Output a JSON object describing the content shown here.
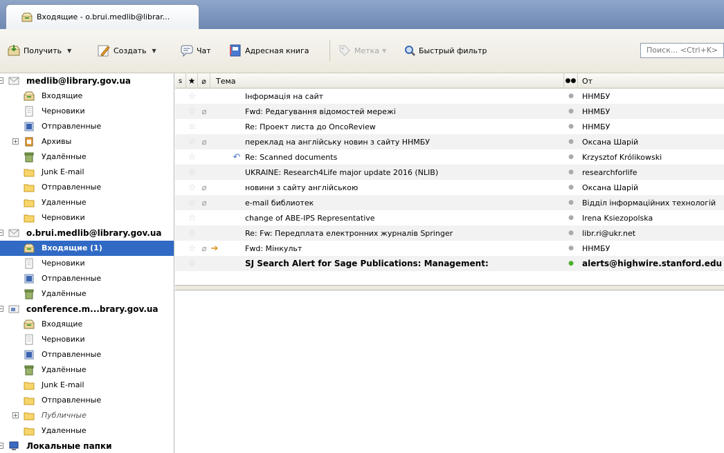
{
  "tab": {
    "label": "Входящие - o.brui.medlib@librar..."
  },
  "toolbar": {
    "get": "Получить",
    "create": "Создать",
    "chat": "Чат",
    "addressbook": "Адресная книга",
    "tag": "Метка",
    "quickfilter": "Быстрый фильтр",
    "search_placeholder": "Поиск... <Ctrl+K>"
  },
  "folders": [
    {
      "label": "medlib@library.gov.ua",
      "type": "account",
      "icon": "account-icon"
    },
    {
      "label": "Входящие",
      "type": "inbox",
      "icon": "inbox-icon"
    },
    {
      "label": "Черновики",
      "type": "drafts",
      "icon": "drafts-icon"
    },
    {
      "label": "Отправленные",
      "type": "sent",
      "icon": "sent-icon"
    },
    {
      "label": "Архивы",
      "type": "archive",
      "icon": "archive-icon"
    },
    {
      "label": "Удалённые",
      "type": "trash",
      "icon": "trash-icon"
    },
    {
      "label": "Junk E-mail",
      "type": "folder",
      "icon": "folder-icon"
    },
    {
      "label": "Отправленные",
      "type": "folder",
      "icon": "folder-icon"
    },
    {
      "label": "Удаленные",
      "type": "folder",
      "icon": "folder-icon"
    },
    {
      "label": "Черновики",
      "type": "folder",
      "icon": "folder-icon"
    },
    {
      "label": "o.brui.medlib@library.gov.ua",
      "type": "account",
      "icon": "account-icon"
    },
    {
      "label": "Входящие (1)",
      "type": "inbox",
      "icon": "inbox-icon"
    },
    {
      "label": "Черновики",
      "type": "drafts",
      "icon": "drafts-icon"
    },
    {
      "label": "Отправленные",
      "type": "sent",
      "icon": "sent-icon"
    },
    {
      "label": "Удалённые",
      "type": "trash",
      "icon": "trash-icon"
    },
    {
      "label": "conference.m...brary.gov.ua",
      "type": "account",
      "icon": "news-account-icon"
    },
    {
      "label": "Входящие",
      "type": "inbox",
      "icon": "inbox-icon"
    },
    {
      "label": "Черновики",
      "type": "drafts",
      "icon": "drafts-icon"
    },
    {
      "label": "Отправленные",
      "type": "sent",
      "icon": "sent-icon"
    },
    {
      "label": "Удалённые",
      "type": "trash",
      "icon": "trash-icon"
    },
    {
      "label": "Junk E-mail",
      "type": "folder",
      "icon": "folder-icon"
    },
    {
      "label": "Отправленные",
      "type": "folder",
      "icon": "folder-icon"
    },
    {
      "label": "Публичные",
      "type": "folder",
      "icon": "folder-icon"
    },
    {
      "label": "Удаленные",
      "type": "folder",
      "icon": "folder-icon"
    },
    {
      "label": "Локальные папки",
      "type": "account",
      "icon": "local-folders-icon"
    }
  ],
  "columns": {
    "subject": "Тема",
    "from": "От"
  },
  "messages": [
    {
      "subject": "Інформація на сайт",
      "from": "ННМБУ"
    },
    {
      "subject": "Fwd: Редагування відомостей мережі",
      "from": "ННМБУ"
    },
    {
      "subject": "Re: Проект листа до OncoReview",
      "from": "ННМБУ"
    },
    {
      "subject": "переклад на англійську новин з сайту ННМБУ",
      "from": "Оксана Шарій"
    },
    {
      "subject": "Re: Scanned documents",
      "from": "Krzysztof Królikowski"
    },
    {
      "subject": "UKRAINE: Research4Life major update 2016 (NLIB)",
      "from": "researchforlife"
    },
    {
      "subject": "новини з сайту англійською",
      "from": "Оксана Шарій"
    },
    {
      "subject": "e-mail библиотек",
      "from": "Відділ інформаційних технологій"
    },
    {
      "subject": "change of ABE-IPS Representative",
      "from": "Irena Ksiezopolska"
    },
    {
      "subject": "Re: Fw: Передплата електронних журналів Springer",
      "from": "libr.ri@ukr.net"
    },
    {
      "subject": "Fwd: Мінкульт",
      "from": "ННМБУ"
    },
    {
      "subject": "SJ Search Alert for Sage Publications: Management:",
      "from": "alerts@highwire.stanford.edu"
    }
  ]
}
